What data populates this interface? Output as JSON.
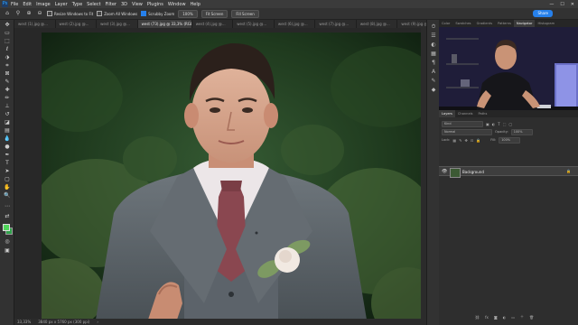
{
  "menubar": {
    "logo": "Ps",
    "items": [
      "File",
      "Edit",
      "Image",
      "Layer",
      "Type",
      "Select",
      "Filter",
      "3D",
      "View",
      "Plugins",
      "Window",
      "Help"
    ],
    "window_controls": [
      "—",
      "☐",
      "✕"
    ]
  },
  "options": {
    "resize_windows": "Resize Windows to Fit",
    "zoom_all": "Zoom All Windows",
    "scrubby_zoom": "Scrubby Zoom",
    "zoom_pct": "100%",
    "fit_screen": "Fit Screen",
    "fill_screen": "Fill Screen",
    "share": "Share"
  },
  "tabs": [
    {
      "label": "west (1).jpg @..."
    },
    {
      "label": "west (2).jpg @..."
    },
    {
      "label": "west (3).jpg @..."
    },
    {
      "label": "west (73).jpg @ 33,3% (RGB/8)"
    },
    {
      "label": "west (4).jpg @..."
    },
    {
      "label": "west (5).jpg @..."
    },
    {
      "label": "west (6).jpg @..."
    },
    {
      "label": "west (7).jpg @..."
    },
    {
      "label": "west (8).jpg @..."
    },
    {
      "label": "west (9).jpg @..."
    }
  ],
  "status": {
    "zoom": "33,33%",
    "doc": "3840 px x 5760 px (300 ppi)"
  },
  "panel_top_tabs": [
    "Color",
    "Swatches",
    "Gradients",
    "Patterns",
    "Navigator",
    "Histogram"
  ],
  "layers_tabs": [
    "Layers",
    "Channels",
    "Paths"
  ],
  "layers": {
    "kind": "Kind",
    "blend": "Normal",
    "opacity_label": "Opacity:",
    "opacity": "100%",
    "lock_label": "Lock:",
    "fill_label": "Fill:",
    "fill": "100%",
    "items": [
      {
        "name": "Background",
        "locked": true,
        "visible": true
      }
    ]
  },
  "colors": {
    "accent": "#2680eb",
    "foreground": "#4fd45a",
    "background": "#2fa34a"
  }
}
